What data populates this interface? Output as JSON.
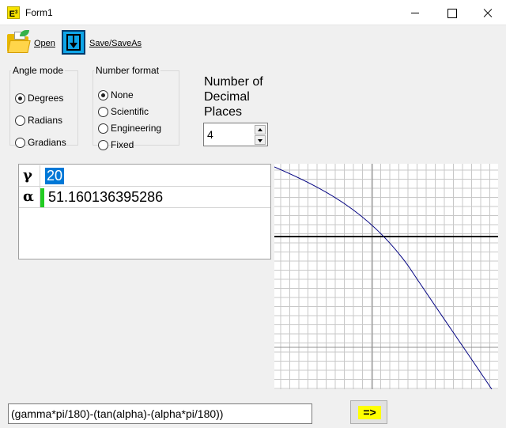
{
  "window": {
    "title": "Form1",
    "icon": "equation-app-icon"
  },
  "toolbar": {
    "open_label": "Open",
    "saveas_label": "Save/SaveAs"
  },
  "angle_mode": {
    "legend": "Angle mode",
    "options": [
      "Degrees",
      "Radians",
      "Gradians"
    ],
    "selected": "Degrees"
  },
  "number_format": {
    "legend": "Number format",
    "options": [
      "None",
      "Scientific",
      "Engineering",
      "Fixed"
    ],
    "selected": "None"
  },
  "decimal_places": {
    "label": "Number of Decimal Places",
    "value": "4"
  },
  "variables": [
    {
      "symbol": "γ",
      "value": "20"
    },
    {
      "symbol": "α",
      "value": "51.160136395286"
    }
  ],
  "expression": {
    "value": "(gamma*pi/180)-(tan(alpha)-(alpha*pi/180))"
  },
  "calculate": {
    "label": "=>"
  },
  "colors": {
    "curve": "#000080",
    "marker": "#22cc22",
    "highlight": "#0078d7",
    "button_face": "#ffff00"
  }
}
